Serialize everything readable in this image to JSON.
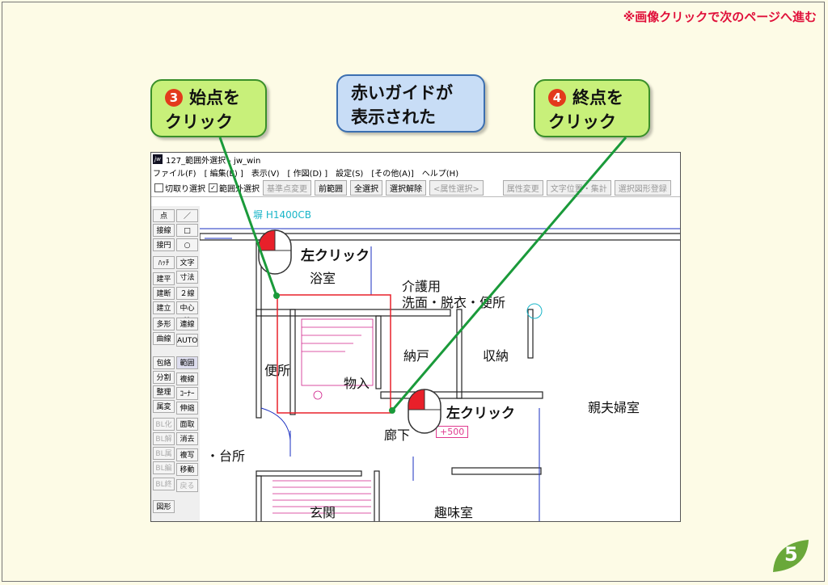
{
  "top_note": "※画像クリックで次のページへ進む",
  "callouts": {
    "step3": {
      "num": "3",
      "line1": "始点を",
      "line2": "クリック"
    },
    "guide": {
      "line1": "赤いガイドが",
      "line2": "表示された"
    },
    "step4": {
      "num": "4",
      "line1": "終点を",
      "line2": "クリック"
    }
  },
  "window": {
    "title": "127_範囲外選択 - jw_win",
    "icon": "jw",
    "menu": [
      "ファイル(F)",
      "[ 編集(E) ]",
      "表示(V)",
      "[ 作図(D) ]",
      "設定(S)",
      "[その他(A)]",
      "ヘルプ(H)"
    ],
    "toolbar": {
      "check1": "切取り選択",
      "check2": "範囲外選択",
      "buttons": [
        "基準点変更",
        "前範囲",
        "全選択",
        "選択解除",
        "<属性選択>",
        "属性変更",
        "文字位置・集計",
        "選択図形登録"
      ]
    },
    "sidebar_left": [
      "点",
      "接線",
      "接円",
      "ﾊｯﾁ",
      "建平",
      "建断",
      "建立",
      "多形",
      "曲線",
      "包絡",
      "分割",
      "整理",
      "属変",
      "BL化",
      "BL解",
      "BL属",
      "BL編",
      "BL終",
      "図形"
    ],
    "sidebar_right": [
      "／",
      "□",
      "○",
      "文字",
      "寸法",
      "２線",
      "中心線",
      "連線",
      "AUTO",
      "範囲",
      "複線",
      "ｺｰﾅｰ",
      "伸縮",
      "面取",
      "消去",
      "複写",
      "移動",
      "戻る"
    ],
    "canvas": {
      "cyan_label": "塀 H1400CB",
      "rooms": [
        "浴室",
        "介護用",
        "洗面・脱衣・便所",
        "納戸",
        "収納",
        "便所",
        "物入",
        "廊下",
        "親夫婦室",
        "・台所",
        "玄関",
        "趣味室"
      ],
      "dim": "+500",
      "click1": "左クリック",
      "click2": "左クリック"
    }
  },
  "page_number": "5",
  "colors": {
    "accent_red": "#e0103a",
    "callout_green": "#c8f07a",
    "callout_blue": "#c8ddf6",
    "badge_green": "#6aa83a"
  }
}
